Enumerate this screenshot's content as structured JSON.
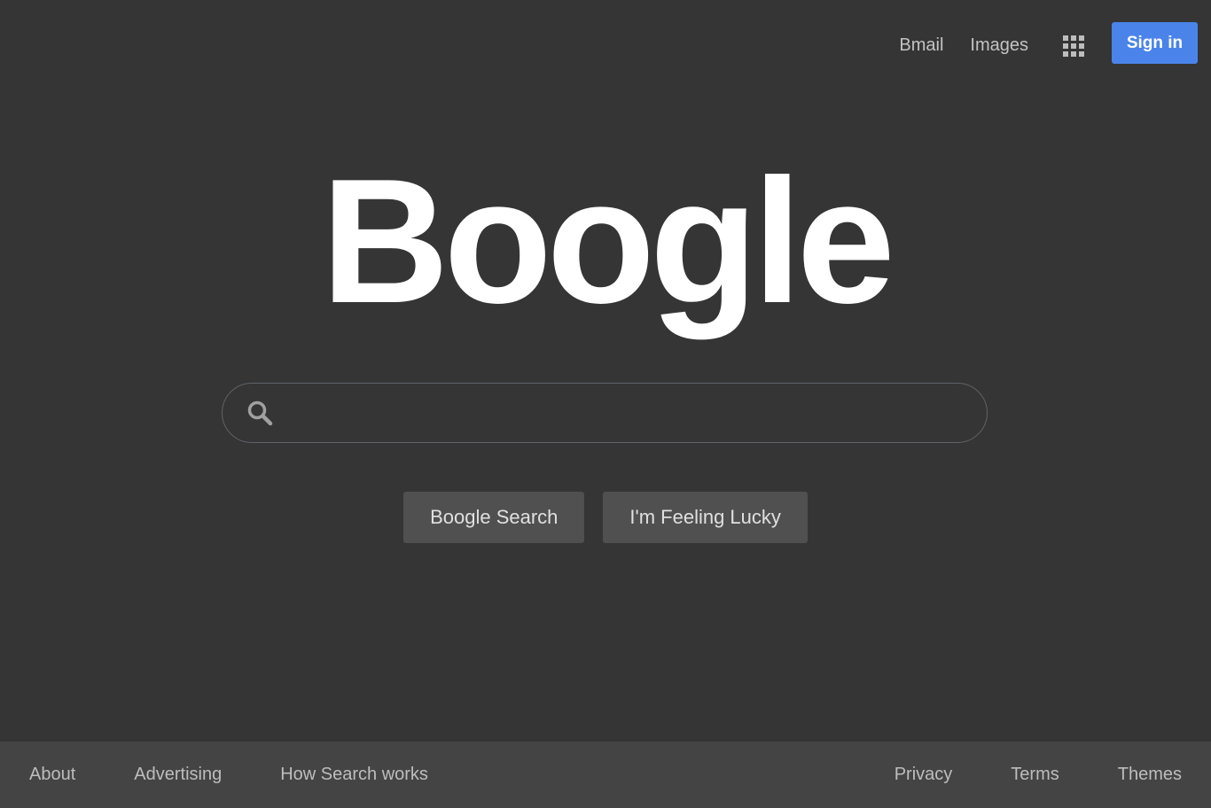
{
  "header": {
    "links": [
      "Bmail",
      "Images"
    ],
    "apps_icon": "grid-apps-icon",
    "signin_label": "Sign in"
  },
  "logo": {
    "text": "Boogle"
  },
  "search": {
    "icon": "search-icon",
    "value": "",
    "placeholder": ""
  },
  "buttons": {
    "search_label": "Boogle Search",
    "lucky_label": "I'm Feeling Lucky"
  },
  "footer": {
    "left_links": [
      "About",
      "Advertising",
      "How Search works"
    ],
    "right_links": [
      "Privacy",
      "Terms",
      "Themes"
    ]
  },
  "colors": {
    "background": "#353535",
    "footer_background": "#444444",
    "accent": "#4a84ea",
    "button_background": "#505050"
  }
}
